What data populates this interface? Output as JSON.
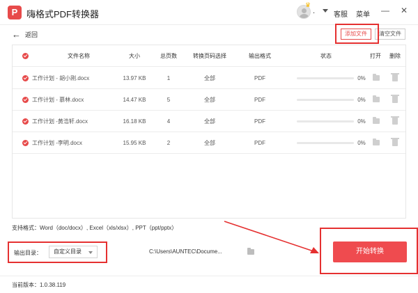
{
  "app": {
    "title": "嗨格式PDF转换器",
    "logo_text": "P"
  },
  "topbar": {
    "user_name": ".",
    "service_label": "客服",
    "menu_label": "菜单",
    "minimize": "—",
    "close": "✕"
  },
  "toolbar": {
    "back_label": "返回",
    "add_file": "添加文件",
    "clear_files": "清空文件"
  },
  "table": {
    "headers": {
      "name": "文件名称",
      "size": "大小",
      "pages": "总页数",
      "range": "转换页码选择",
      "format": "输出格式",
      "status": "状态",
      "open": "打开",
      "delete": "删除"
    },
    "rows": [
      {
        "name": "工作计划 - 胡小刚.docx",
        "size": "13.97 KB",
        "pages": "1",
        "range": "全部",
        "format": "PDF",
        "progress": "0%",
        "progress_value": 0
      },
      {
        "name": "工作计划 - 慕林.docx",
        "size": "14.47 KB",
        "pages": "5",
        "range": "全部",
        "format": "PDF",
        "progress": "0%",
        "progress_value": 0
      },
      {
        "name": "工作计划 -黄浩轩.docx",
        "size": "16.18 KB",
        "pages": "4",
        "range": "全部",
        "format": "PDF",
        "progress": "0%",
        "progress_value": 0
      },
      {
        "name": "工作计划 -李明.docx",
        "size": "15.95 KB",
        "pages": "2",
        "range": "全部",
        "format": "PDF",
        "progress": "0%",
        "progress_value": 0
      }
    ]
  },
  "formats": {
    "label": "支持格式：",
    "list": "Word（doc/docx）, Excel（xls/xlsx）, PPT（ppt/pptx）"
  },
  "output": {
    "label": "输出目录：",
    "selected": "自定义目录",
    "path": "C:\\Users\\AUNTEC\\Docume..."
  },
  "actions": {
    "start": "开始转换"
  },
  "footer": {
    "version": "当前版本：1.0.38.119"
  },
  "colors": {
    "accent": "#ef4b4f",
    "annotation": "#e53030"
  },
  "icons": [
    "back-arrow-icon",
    "check-circle-icon",
    "folder-icon",
    "trash-icon",
    "crown-icon",
    "avatar-icon"
  ]
}
